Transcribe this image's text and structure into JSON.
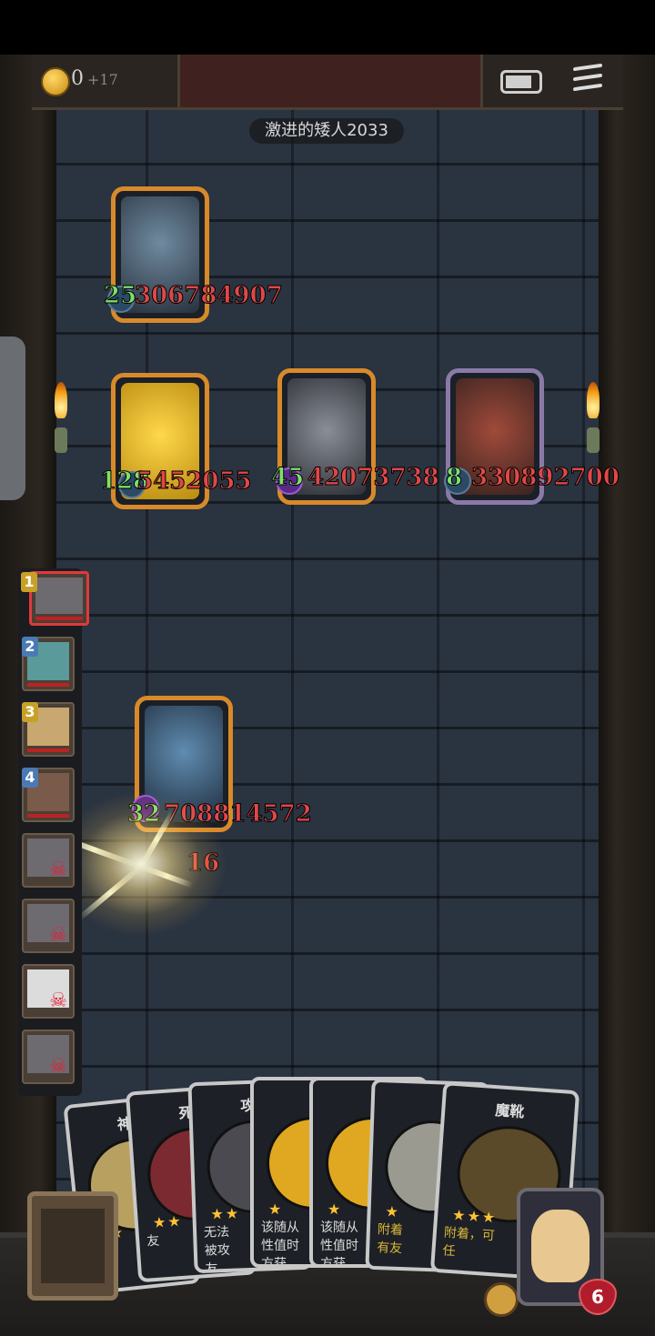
{
  "header": {
    "coins": "0",
    "coin_gain": "+17",
    "menu_icon": "menu-icon",
    "battery_icon": "battery-icon"
  },
  "opponent": {
    "name": "激进的矮人2033"
  },
  "enemy_cards": [
    {
      "atk": "25",
      "hp": "306784907"
    },
    {
      "atk": "128",
      "hp": "5452055"
    },
    {
      "atk": "45",
      "hp": "42073738"
    },
    {
      "atk": "8",
      "hp": "330892700"
    }
  ],
  "player_card": {
    "atk": "32",
    "hp": "708814572",
    "hit": "16"
  },
  "queue": [
    {
      "num": "1",
      "num_color": "#c8a028",
      "state": "active"
    },
    {
      "num": "2",
      "num_color": "#4a7ab4",
      "state": "alive"
    },
    {
      "num": "3",
      "num_color": "#c8a028",
      "state": "alive"
    },
    {
      "num": "4",
      "num_color": "#4a7ab4",
      "state": "alive"
    },
    {
      "num": "",
      "state": "dead",
      "skull": "☠"
    },
    {
      "num": "",
      "state": "dead",
      "skull": "☠"
    },
    {
      "num": "",
      "state": "dead",
      "skull": "☠"
    },
    {
      "num": "",
      "state": "dead",
      "skull": "☠"
    }
  ],
  "hand": [
    {
      "title": "神",
      "stars": "★★",
      "desc": ""
    },
    {
      "title": "死",
      "stars": "★★",
      "desc": "友"
    },
    {
      "title": "攻",
      "stars": "★★",
      "desc": "无法\n被攻\n友"
    },
    {
      "title": "",
      "stars": "★",
      "desc": "该随从\n性值时\n方获"
    },
    {
      "title": "",
      "stars": "★",
      "desc": "该随从\n性值时\n方获"
    },
    {
      "title": "",
      "stars": "★",
      "desc": "附着\n有友",
      "gold": true
    },
    {
      "title": "魔靴",
      "stars": "★★★",
      "desc": "附着，可\n任",
      "gold": true
    }
  ],
  "hero": {
    "hp": "6"
  }
}
